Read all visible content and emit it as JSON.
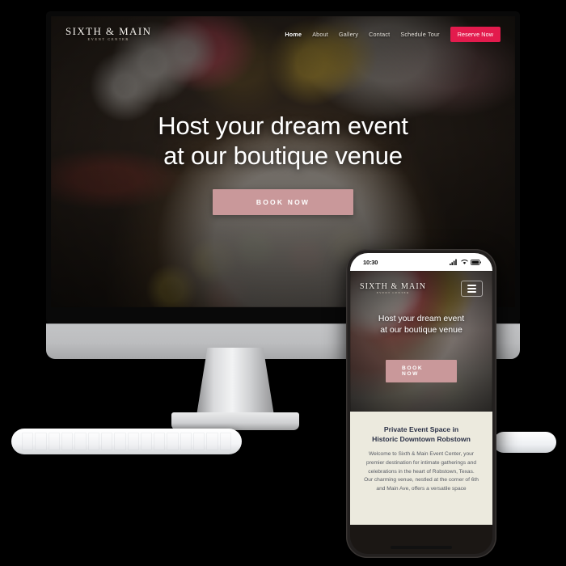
{
  "brand": {
    "logo_main": "SIXTH & MAIN",
    "logo_sub": "EVENT CENTER"
  },
  "desktop": {
    "nav": {
      "links": [
        {
          "label": "Home",
          "active": true
        },
        {
          "label": "About",
          "active": false
        },
        {
          "label": "Gallery",
          "active": false
        },
        {
          "label": "Contact",
          "active": false
        },
        {
          "label": "Schedule Tour",
          "active": false
        }
      ],
      "cta_label": "Reserve Now",
      "cta_color": "#e31b4d"
    },
    "hero": {
      "title_line1": "Host your dream event",
      "title_line2": "at our boutique venue",
      "button_label": "BOOK NOW",
      "button_color": "#c9989a"
    }
  },
  "phone": {
    "status": {
      "time": "10:30",
      "signal_icon": "cellular-signal-icon",
      "wifi_icon": "wifi-icon",
      "battery_icon": "battery-icon"
    },
    "menu_icon": "hamburger-menu-icon",
    "hero": {
      "title_line1": "Host your dream event",
      "title_line2": "at our boutique venue",
      "button_label": "BOOK NOW"
    },
    "section": {
      "title_line1": "Private Event Space in",
      "title_line2": "Historic Downtown Robstown",
      "body": "Welcome to Sixth & Main Event Center, your premier destination for intimate gatherings and celebrations in the heart of Robstown, Texas. Our charming venue, nestled at the corner of 6th and Main Ave, offers a versatile space",
      "bg_color": "#eceade",
      "title_color": "#2a3046"
    }
  }
}
